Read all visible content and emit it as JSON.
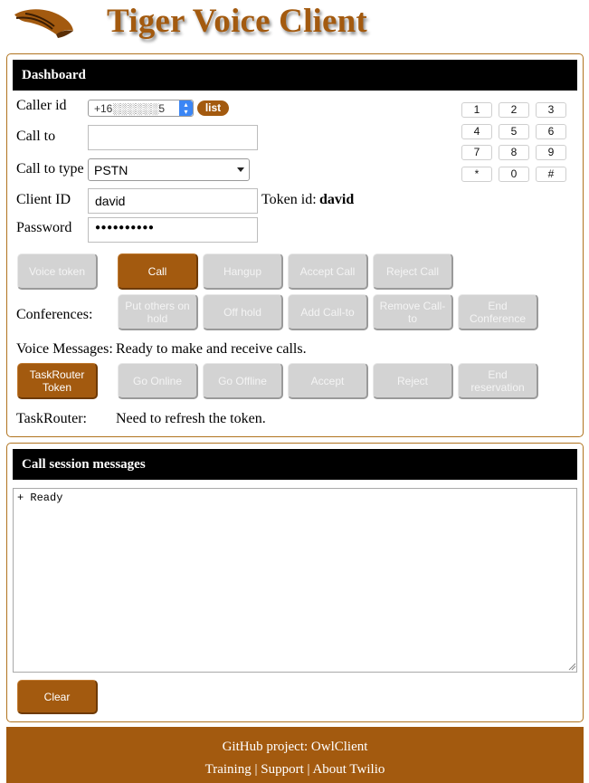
{
  "header": {
    "title": "Tiger Voice Client",
    "logo_icon": "tiger-claw-icon"
  },
  "dashboard": {
    "bar_title": "Dashboard",
    "caller_id_label": "Caller id",
    "caller_id_value": "+16░░░░░░5",
    "list_button": "list",
    "call_to_label": "Call to",
    "call_to_value": "",
    "call_to_type_label": "Call to type",
    "call_to_type_value": "PSTN",
    "client_id_label": "Client ID",
    "client_id_value": "david",
    "token_id_label": "Token id:",
    "token_id_value": "david",
    "password_label": "Password",
    "password_value": "●●●●●●●●●●",
    "keypad": [
      "1",
      "2",
      "3",
      "4",
      "5",
      "6",
      "7",
      "8",
      "9",
      "*",
      "0",
      "#"
    ],
    "buttons_row1": {
      "voice_token": "Voice token",
      "call": "Call",
      "hangup": "Hangup",
      "accept_call": "Accept Call",
      "reject_call": "Reject Call"
    },
    "conferences_label": "Conferences:",
    "buttons_conf": {
      "put_others_on_hold": "Put others on hold",
      "off_hold": "Off hold",
      "add_call_to": "Add Call-to",
      "remove_call_to": "Remove Call-to",
      "end_conference": "End Conference"
    },
    "voice_messages_label": "Voice Messages:",
    "voice_messages_value": "Ready to make and receive calls.",
    "buttons_taskrouter": {
      "taskrouter_token": "TaskRouter Token",
      "go_online": "Go Online",
      "go_offline": "Go Offline",
      "accept": "Accept",
      "reject": "Reject",
      "end_reservation": "End reservation"
    },
    "taskrouter_label": "TaskRouter:",
    "taskrouter_value": "Need to refresh the token."
  },
  "session": {
    "bar_title": "Call session messages",
    "log_text": "+ Ready",
    "clear_button": "Clear"
  },
  "footer": {
    "github_link": "GitHub project: OwlClient",
    "training_link": "Training",
    "support_link": "Support",
    "about_link": "About Twilio",
    "separator": "|"
  },
  "colors": {
    "brand": "#a35a0f",
    "bar": "#000000",
    "button_disabled": "#d3d3d3",
    "select_accent": "#3b86f5"
  }
}
